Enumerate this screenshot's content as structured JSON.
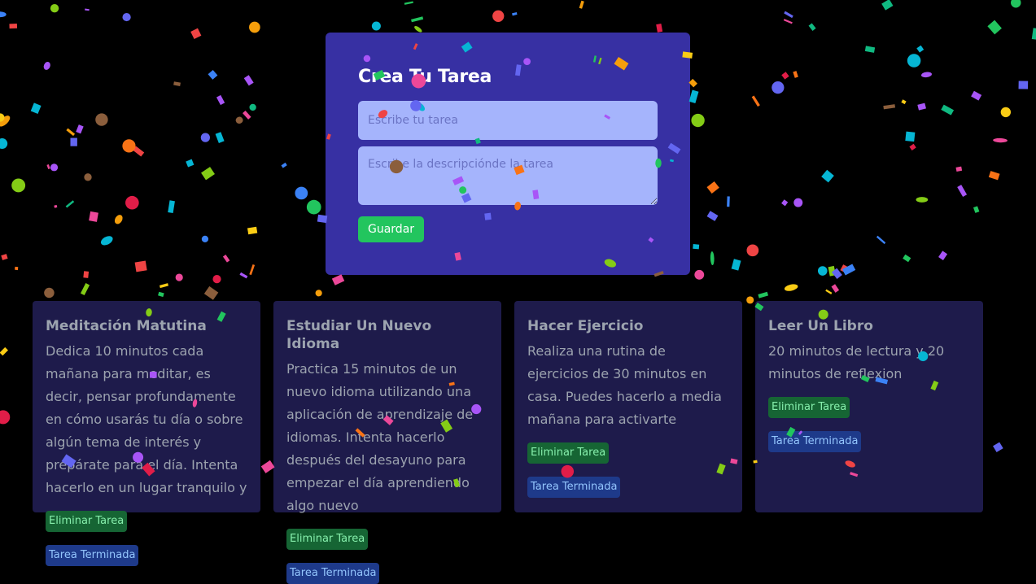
{
  "form": {
    "title": "Crea Tu Tarea",
    "task_placeholder": "Escribe tu tarea",
    "task_value": "",
    "description_placeholder": "Escribe la descripciónde la tarea",
    "description_value": "",
    "save_label": "Guardar"
  },
  "tasks": [
    {
      "title": "Meditación Matutina",
      "description": "Dedica 10 minutos cada mañana para meditar, es decir, pensar profundamente en cómo usarás tu día o sobre algún tema de interés y prepárate para el día. Intenta hacerlo en un lugar tranquilo y",
      "delete_label": "Eliminar Tarea",
      "done_label": "Tarea Terminada"
    },
    {
      "title": "Estudiar Un Nuevo Idioma",
      "description": "Practica 15 minutos de un nuevo idioma utilizando una aplicación de aprendizaje de idiomas. Intenta hacerlo después del desayuno para empezar el día aprendiendo algo nuevo",
      "delete_label": "Eliminar Tarea",
      "done_label": "Tarea Terminada"
    },
    {
      "title": "Hacer Ejercicio",
      "description": "Realiza una rutina de ejercicios de 30 minutos en casa. Puedes hacerlo a media mañana para activarte",
      "delete_label": "Eliminar Tarea",
      "done_label": "Tarea Terminada"
    },
    {
      "title": "Leer Un Libro",
      "description": "20 minutos de lectura y 20 minutos de reflexion",
      "delete_label": "Eliminar Tarea",
      "done_label": "Tarea Terminada"
    }
  ],
  "colors": {
    "background": "#000000",
    "form_bg": "#3730a3",
    "input_bg": "#a5b4fc",
    "save_button": "#22c55e",
    "card_bg": "#1e1b4b",
    "delete_button": "#166534",
    "done_button": "#1e3a8a",
    "confetti": [
      "#ef4444",
      "#f59e0b",
      "#facc15",
      "#22c55e",
      "#10b981",
      "#06b6d4",
      "#3b82f6",
      "#6366f1",
      "#a855f7",
      "#ec4899",
      "#f97316",
      "#84cc16",
      "#e11d48",
      "#8b5e3c"
    ]
  }
}
